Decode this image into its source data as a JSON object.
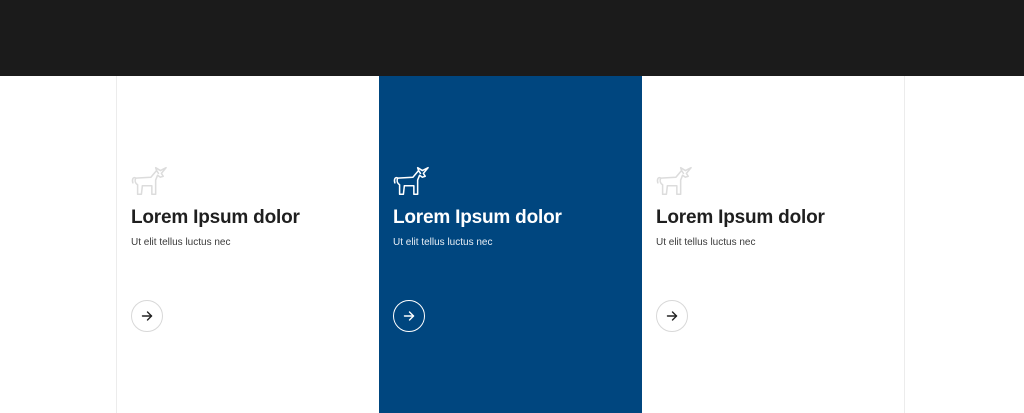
{
  "icons": {
    "card": "unicorn-icon",
    "button": "arrow-right-icon"
  },
  "colors": {
    "topbar": "#1b1b1b",
    "active_card": "#00467f",
    "text_dark": "#1f1f1f",
    "icon_muted": "#dcdcdc"
  },
  "cards": [
    {
      "title": "Lorem Ipsum dolor",
      "text": "Ut elit tellus luctus nec"
    },
    {
      "title": "Lorem Ipsum dolor",
      "text": "Ut elit tellus luctus nec"
    },
    {
      "title": "Lorem Ipsum dolor",
      "text": "Ut elit tellus luctus nec"
    }
  ]
}
